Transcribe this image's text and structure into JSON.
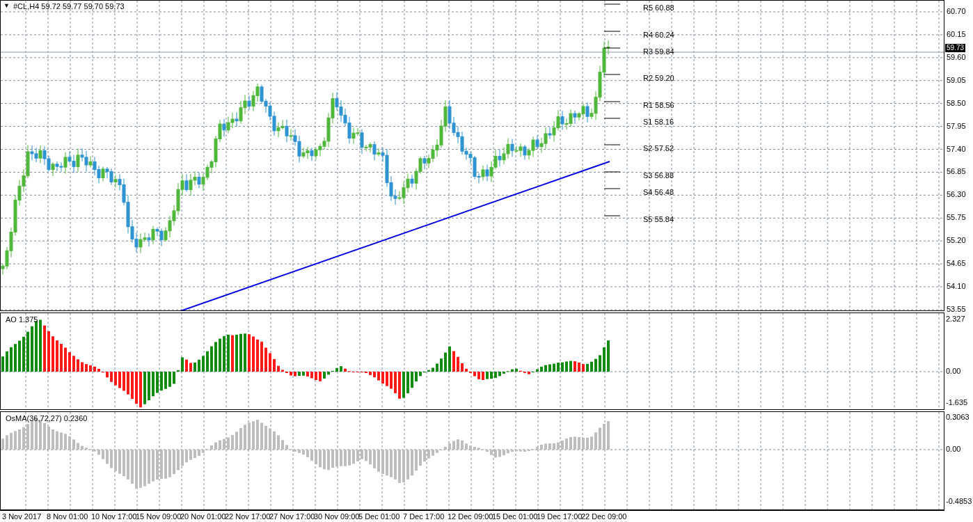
{
  "chart": {
    "menu_glyph": "▼",
    "symbol_label": "#CL,H4  59.72 59.77 59.70 59.73",
    "current_price": "59.73",
    "price_axis": [
      "60.70",
      "60.15",
      "59.60",
      "59.05",
      "58.50",
      "57.95",
      "57.40",
      "56.85",
      "56.30",
      "55.75",
      "55.20",
      "54.65",
      "54.10",
      "53.55"
    ],
    "pivots": [
      {
        "label": "R5 60.88"
      },
      {
        "label": "R4 60.24"
      },
      {
        "label": "R3 59.84"
      },
      {
        "label": "R2 59.20"
      },
      {
        "label": "R1 58.56"
      },
      {
        "label": "S1 58.16"
      },
      {
        "label": "S2 57.52"
      },
      {
        "label": "S3 56.88"
      },
      {
        "label": "S4 56.48"
      },
      {
        "label": "S5 55.84"
      }
    ]
  },
  "ao": {
    "title": "AO 1.375",
    "axis": [
      "2.327",
      "0.00",
      "-1.635"
    ]
  },
  "osma": {
    "title": "OsMA(36,72,27) 0.2360",
    "axis": [
      "0.3063",
      "0.00",
      "-0.4853"
    ]
  },
  "time_axis": [
    "3 Nov 2017",
    "8 Nov 01:00",
    "10 Nov 17:00",
    "15 Nov 09:00",
    "20 Nov 01:00",
    "22 Nov 17:00",
    "27 Nov 17:00",
    "30 Nov 09:00",
    "5 Dec 01:00",
    "7 Dec 17:00",
    "12 Dec 09:00",
    "15 Dec 01:00",
    "19 Dec 17:00",
    "22 Dec 09:00"
  ]
}
